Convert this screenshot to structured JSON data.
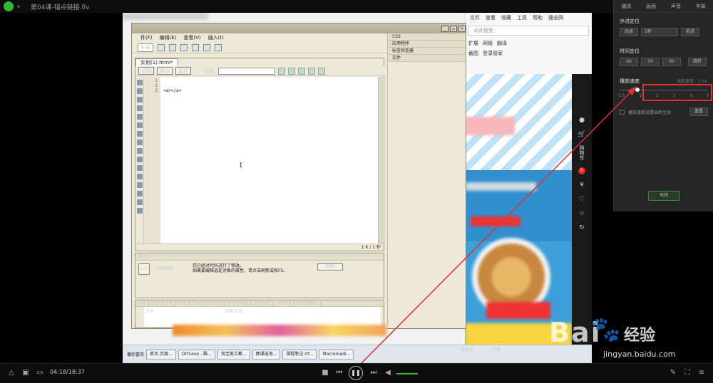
{
  "player": {
    "title": "第04课-锚点链接.flv",
    "time": "04:18/18:37"
  },
  "browser": {
    "menu": [
      "文件",
      "查看",
      "收藏",
      "工具",
      "帮助"
    ],
    "search_btn": "搜全网",
    "address_placeholder": "点此搜索",
    "toolbar": [
      "扩展",
      "网银",
      "翻译",
      "截图",
      "登录管家"
    ]
  },
  "dreamweaver": {
    "menu": [
      "件(F)",
      "编辑(E)",
      "查看(V)",
      "插入(I)"
    ],
    "insert_label": "布局",
    "doc_tab": "实例(1).html*",
    "view_buttons": [
      "代码",
      "拆分",
      "设计"
    ],
    "title_label": "标题:",
    "line_numbers": [
      "1",
      "2",
      "3"
    ],
    "code_line3": "<a></a>",
    "status": "1 K / 1 秒",
    "panels": [
      "CSS",
      "应用程序",
      "标签检查器",
      "文件"
    ],
    "properties": {
      "header": "属性",
      "code_view": "代码视图",
      "message_line1": "您已经对代码进行了修改。",
      "message_line2": "如果要编辑选定对象的属性，请点击刷新或按F5。",
      "refresh": "刷新"
    },
    "results": {
      "header": "结果",
      "tabs": [
        "搜索",
        "参考",
        "验证",
        "目标浏览器检查",
        "链接检查器",
        "站点报告",
        "FTP记录",
        "服务器调试"
      ],
      "col_file": "文件",
      "col_match": "匹配文本"
    }
  },
  "site_sidebar": {
    "cart": "购物车",
    "cart_count": "0",
    "service": "客服"
  },
  "taskbar": {
    "start": "播你喜欢",
    "items": [
      "首页-百度...",
      "DIYLove - 酷...",
      "淘宝美工教...",
      "静课选淘...",
      "课程笔记.rtf...",
      "Macromedi..."
    ],
    "accelerate": "加速器",
    "download": "下载"
  },
  "settings": {
    "tabs": [
      "播放",
      "画面",
      "声音",
      "字幕"
    ],
    "step_label": "步进定位",
    "step_back": "后退",
    "step_value": "5秒",
    "step_forward": "前进",
    "time_label": "时间定位",
    "time_h": "00",
    "time_m": "30",
    "time_s": "00",
    "jump": "跳转",
    "speed_label": "播放速度",
    "speed_current": "当前速度：1.0x",
    "speed_ticks": [
      "0.5",
      "1",
      "2",
      "3",
      "4",
      "5"
    ],
    "speed_value": 1.0,
    "keep_speed_label": "播放速度设置始终生效",
    "reset": "重置",
    "close": "关闭"
  },
  "watermark": {
    "brand": "Bai",
    "cn": "经验",
    "url": "jingyan.baidu.com"
  },
  "colors": {
    "accent_green": "#36c236",
    "highlight_red": "#e0312f"
  }
}
